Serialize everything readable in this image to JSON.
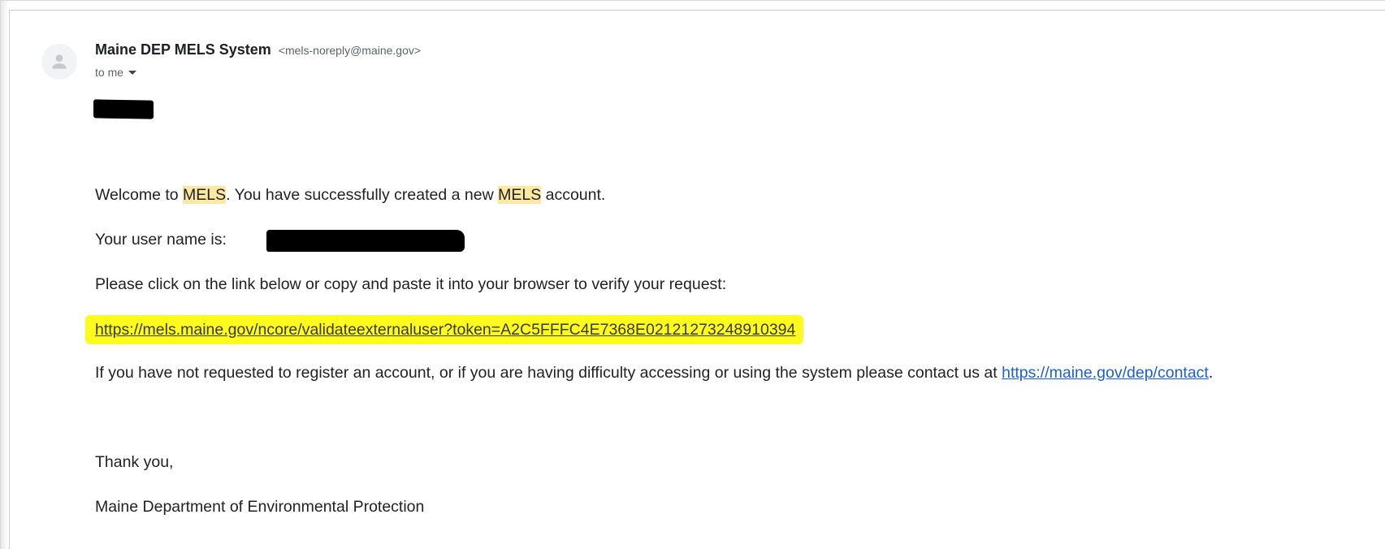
{
  "email": {
    "sender_name": "Maine DEP MELS System",
    "sender_email": "<mels-noreply@maine.gov>",
    "recipient_label": "to me",
    "body": {
      "welcome_prefix": "Welcome to ",
      "mels_1": "MELS",
      "welcome_middle": ".  You have successfully created a new ",
      "mels_2": "MELS",
      "welcome_suffix": " account.",
      "username_label": "Your user name is:",
      "instruction": "Please click on the link below or copy and paste it into your browser to verify your request:",
      "verify_link": "https://mels.maine.gov/ncore/validateexternaluser?token=A2C5FFFC4E7368E02121273248910394",
      "contact_prefix": "If you have not requested to register an account, or if you are having difficulty accessing or using the system please contact us at ",
      "contact_link": "https://maine.gov/dep/contact",
      "contact_suffix": ".",
      "thanks": "Thank you,",
      "signature": "Maine Department of Environmental Protection"
    }
  },
  "icons": {
    "avatar": "person-icon",
    "recipient_toggle": "caret-down-icon"
  },
  "colors": {
    "mels_highlight": "#fce8a1",
    "link_highlight": "#fdfb1d",
    "link_blue": "#1a5fd6",
    "text": "#222222"
  }
}
